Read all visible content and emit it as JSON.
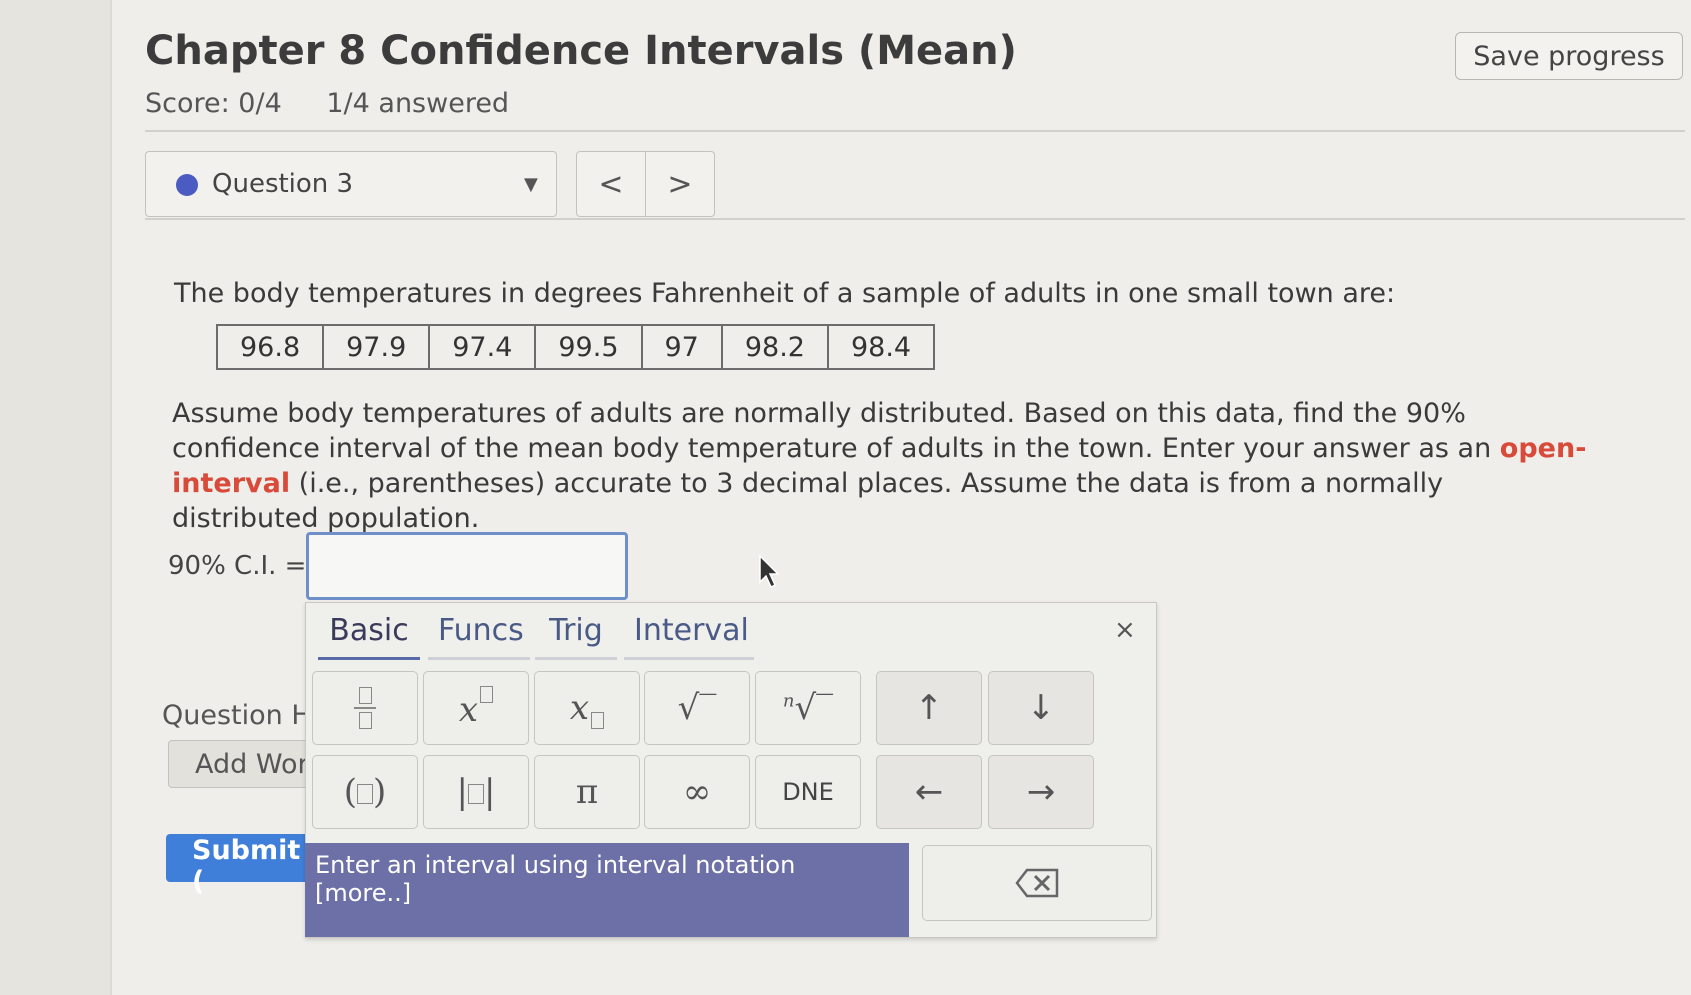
{
  "header": {
    "title": "Chapter 8 Confidence Intervals (Mean)",
    "score": "Score: 0/4",
    "answered": "1/4 answered",
    "save_label": "Save progress"
  },
  "question_nav": {
    "selected": "Question 3",
    "prev_label": "<",
    "next_label": ">"
  },
  "problem": {
    "intro": "The body temperatures in degrees Fahrenheit of a sample of adults in one small town are:",
    "data": [
      "96.8",
      "97.9",
      "97.4",
      "99.5",
      "97",
      "98.2",
      "98.4"
    ],
    "text_before": "Assume body temperatures of adults are normally distributed. Based on this data, find the 90% confidence interval of the mean body temperature of adults in the town. Enter your answer as an ",
    "highlight": "open-interval",
    "text_after": " (i.e., parentheses) accurate to 3 decimal places. Assume the data is from a normally distributed population.",
    "answer_label": "90% C.I. =",
    "answer_value": ""
  },
  "footer": {
    "question_help": "Question H",
    "add_work": "Add Wor",
    "submit": "Submit ("
  },
  "palette": {
    "tabs": [
      "Basic",
      "Funcs",
      "Trig",
      "Interval"
    ],
    "active_tab": "Basic",
    "close": "×",
    "keys": {
      "pi": "π",
      "infinity": "∞",
      "dne": "DNE",
      "up": "↑",
      "down": "↓",
      "left": "←",
      "right": "→",
      "nth_n": "n"
    },
    "hint": "Enter an interval using interval notation [more..]"
  },
  "colors": {
    "accent": "#4a5bc2",
    "highlight": "#d84a3a",
    "submit": "#3f7fd9",
    "hint_bg": "#6c70a6"
  }
}
